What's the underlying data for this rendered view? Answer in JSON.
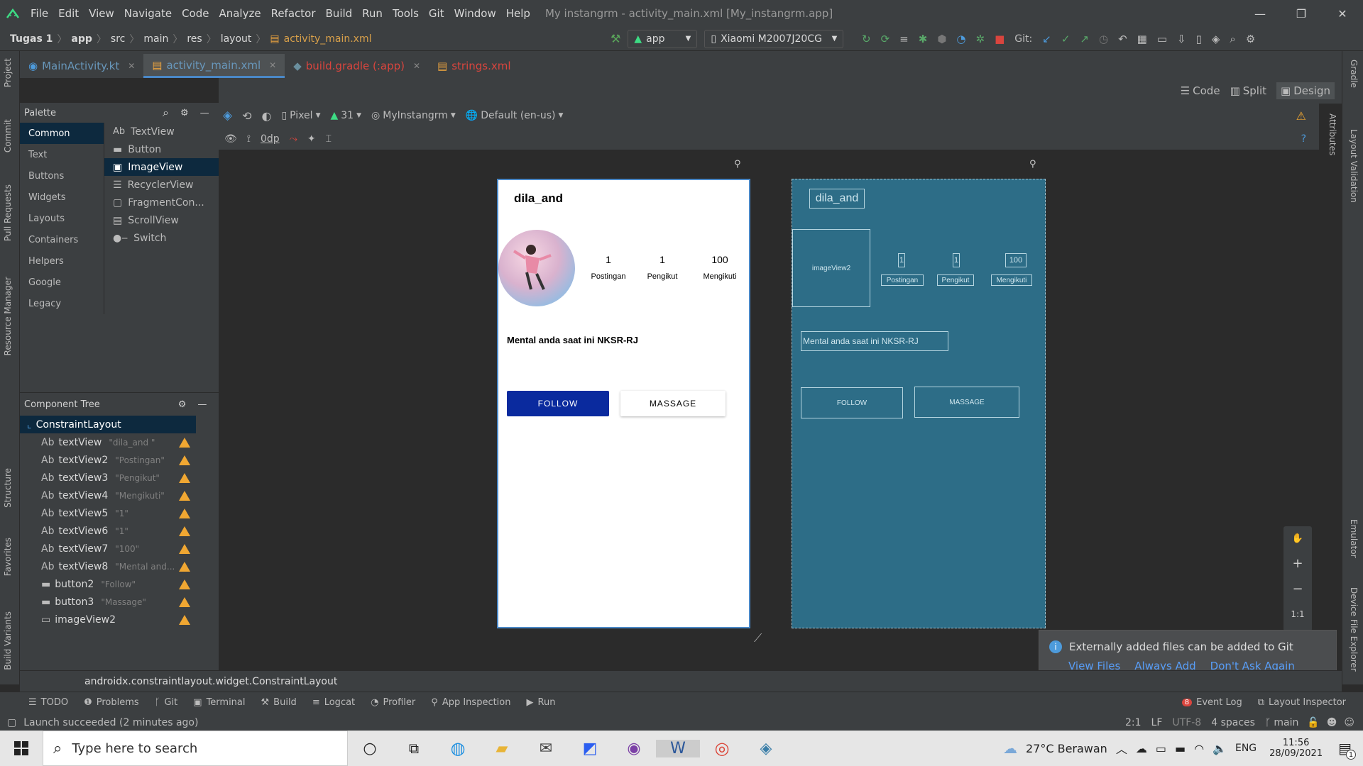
{
  "menu": {
    "items": [
      "File",
      "Edit",
      "View",
      "Navigate",
      "Code",
      "Analyze",
      "Refactor",
      "Build",
      "Run",
      "Tools",
      "Git",
      "Window",
      "Help"
    ],
    "window_title": "My instangrm - activity_main.xml [My_instangrm.app]"
  },
  "breadcrumb": [
    "Tugas 1",
    "app",
    "src",
    "main",
    "res",
    "layout",
    "activity_main.xml"
  ],
  "toolbar": {
    "run_config": "app",
    "device": "Xiaomi M2007J20CG",
    "git_label": "Git:"
  },
  "tabs": [
    {
      "label": "MainActivity.kt",
      "active": false
    },
    {
      "label": "activity_main.xml",
      "active": true
    },
    {
      "label": "build.gradle (:app)",
      "active": false
    },
    {
      "label": "strings.xml",
      "active": false
    }
  ],
  "view_modes": {
    "code": "Code",
    "split": "Split",
    "design": "Design"
  },
  "left_strip": [
    "Project",
    "Commit",
    "Pull Requests",
    "Resource Manager",
    "Structure",
    "Favorites",
    "Build Variants"
  ],
  "right_strip": [
    "Gradle",
    "Attributes",
    "Layout Validation",
    "Emulator",
    "Device File Explorer"
  ],
  "palette": {
    "title": "Palette",
    "categories": [
      "Common",
      "Text",
      "Buttons",
      "Widgets",
      "Layouts",
      "Containers",
      "Helpers",
      "Google",
      "Legacy"
    ],
    "items": [
      {
        "label": "TextView",
        "icon": "Ab"
      },
      {
        "label": "Button",
        "icon": "button-icon"
      },
      {
        "label": "ImageView",
        "icon": "image-icon"
      },
      {
        "label": "RecyclerView",
        "icon": "list-icon"
      },
      {
        "label": "FragmentCon...",
        "icon": "fragment-icon"
      },
      {
        "label": "ScrollView",
        "icon": "scroll-icon"
      },
      {
        "label": "Switch",
        "icon": "switch-icon"
      }
    ]
  },
  "design_toolbar": {
    "device": "Pixel",
    "api": "31",
    "theme": "MyInstangrm",
    "locale": "Default (en-us)",
    "margin": "0dp"
  },
  "component_tree": {
    "title": "Component Tree",
    "root": "ConstraintLayout",
    "nodes": [
      {
        "type": "Ab",
        "name": "textView",
        "value": "\"dila_and \""
      },
      {
        "type": "Ab",
        "name": "textView2",
        "value": "\"Postingan\""
      },
      {
        "type": "Ab",
        "name": "textView3",
        "value": "\"Pengikut\""
      },
      {
        "type": "Ab",
        "name": "textView4",
        "value": "\"Mengikuti\""
      },
      {
        "type": "Ab",
        "name": "textView5",
        "value": "\"1\""
      },
      {
        "type": "Ab",
        "name": "textView6",
        "value": "\"1\""
      },
      {
        "type": "Ab",
        "name": "textView7",
        "value": "\"100\""
      },
      {
        "type": "Ab",
        "name": "textView8",
        "value": "\"Mental and..."
      },
      {
        "type": "btn",
        "name": "button2",
        "value": "\"Follow\""
      },
      {
        "type": "btn",
        "name": "button3",
        "value": "\"Massage\""
      },
      {
        "type": "img",
        "name": "imageView2",
        "value": ""
      }
    ]
  },
  "phone": {
    "username": "dila_and",
    "stats": [
      {
        "value": "1",
        "label": "Postingan"
      },
      {
        "value": "1",
        "label": "Pengikut"
      },
      {
        "value": "100",
        "label": "Mengikuti"
      }
    ],
    "bio": "Mental anda saat ini NKSR-RJ",
    "follow": "FOLLOW",
    "message": "MASSAGE"
  },
  "blueprint": {
    "username": "dila_and",
    "image": "imageView2",
    "stats": [
      "1",
      "1",
      "100"
    ],
    "labels": [
      "Postingan",
      "Pengikut",
      "Mengikuti"
    ],
    "bio": "Mental anda saat ini NKSR-RJ",
    "follow": "FOLLOW",
    "message": "MASSAGE"
  },
  "zoom": {
    "plus": "+",
    "minus": "−",
    "fit": "1:1"
  },
  "notification": {
    "text": "Externally added files can be added to Git",
    "links": [
      "View Files",
      "Always Add",
      "Don't Ask Again"
    ]
  },
  "status_path": "androidx.constraintlayout.widget.ConstraintLayout",
  "bottom_tools": [
    "TODO",
    "Problems",
    "Git",
    "Terminal",
    "Build",
    "Logcat",
    "Profiler",
    "App Inspection",
    "Run"
  ],
  "event_log": {
    "badge": "8",
    "label": "Event Log"
  },
  "layout_inspector": "Layout Inspector",
  "status": {
    "message": "Launch succeeded (2 minutes ago)",
    "position": "2:1",
    "line_sep": "LF",
    "encoding": "UTF-8",
    "indent": "4 spaces",
    "branch": "main"
  },
  "taskbar": {
    "search_placeholder": "Type here to search",
    "weather": "27°C  Berawan",
    "lang": "ENG",
    "time": "11:56",
    "date": "28/09/2021",
    "notif_count": "1"
  }
}
